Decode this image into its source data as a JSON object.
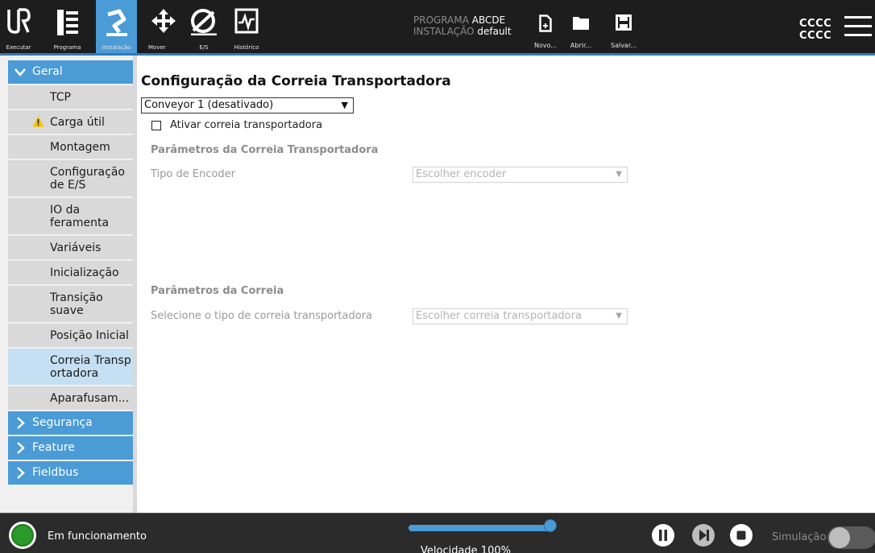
{
  "header": {
    "nav": [
      {
        "id": "run",
        "label": "Executar",
        "icon": "ur-logo-icon"
      },
      {
        "id": "program",
        "label": "Programa",
        "icon": "program-icon"
      },
      {
        "id": "installation",
        "label": "Instalação",
        "icon": "installation-robot-icon",
        "active": true
      },
      {
        "id": "move",
        "label": "Mover",
        "icon": "move-arrows-icon"
      },
      {
        "id": "io",
        "label": "E/S",
        "icon": "io-icon"
      },
      {
        "id": "history",
        "label": "Histórico",
        "icon": "history-icon"
      }
    ],
    "program_key": "PROGRAMA",
    "program_value": "ABCDE",
    "installation_key": "INSTALAÇÃO",
    "installation_value": "default",
    "file_buttons": [
      {
        "id": "new",
        "label": "Novo...",
        "icon": "new-file-icon"
      },
      {
        "id": "open",
        "label": "Abrir...",
        "icon": "open-folder-icon"
      },
      {
        "id": "save",
        "label": "Salvar...",
        "icon": "save-disk-icon"
      }
    ],
    "user_line1": "CCCC",
    "user_line2": "CCCC",
    "accent_color": "#4a9bd6"
  },
  "sidebar": {
    "general_label": "Geral",
    "items": [
      {
        "label": "TCP",
        "lines": 1
      },
      {
        "label": "Carga útil",
        "lines": 1,
        "warning": true
      },
      {
        "label": "Montagem",
        "lines": 1
      },
      {
        "label": "Configuração de E/S",
        "lines": 2
      },
      {
        "label": "IO da feramenta",
        "lines": 2
      },
      {
        "label": "Variáveis",
        "lines": 1
      },
      {
        "label": "Inicialização",
        "lines": 1
      },
      {
        "label": "Transição suave",
        "lines": 2
      },
      {
        "label": "Posição Inicial",
        "lines": 1
      },
      {
        "label": "Correia Transportadora",
        "lines": 2,
        "selected": true
      },
      {
        "label": "Aparafusam...",
        "lines": 1
      }
    ],
    "groups": [
      {
        "label": "Segurança"
      },
      {
        "label": "Feature"
      },
      {
        "label": "Fieldbus"
      }
    ]
  },
  "main": {
    "title": "Configuração da Correia Transportadora",
    "conveyor_select": "Conveyor 1 (desativado)",
    "enable_checkbox_label": "Ativar correia transportadora",
    "enable_checked": false,
    "section1_title": "Parâmetros da Correia Transportadora",
    "encoder_label": "Tipo de Encoder",
    "encoder_placeholder": "Escolher encoder",
    "section2_title": "Parâmetros da Correia",
    "conveyor_type_label": "Selecione o tipo de correia transportadora",
    "conveyor_type_placeholder": "Escolher correia transportadora"
  },
  "footer": {
    "status": "Em funcionamento",
    "speed_label": "Velocidade 100%",
    "speed_value": 100,
    "simulation_label": "Simulação",
    "simulation_on": false,
    "controls": [
      "pause-icon",
      "step-icon",
      "stop-icon"
    ]
  }
}
